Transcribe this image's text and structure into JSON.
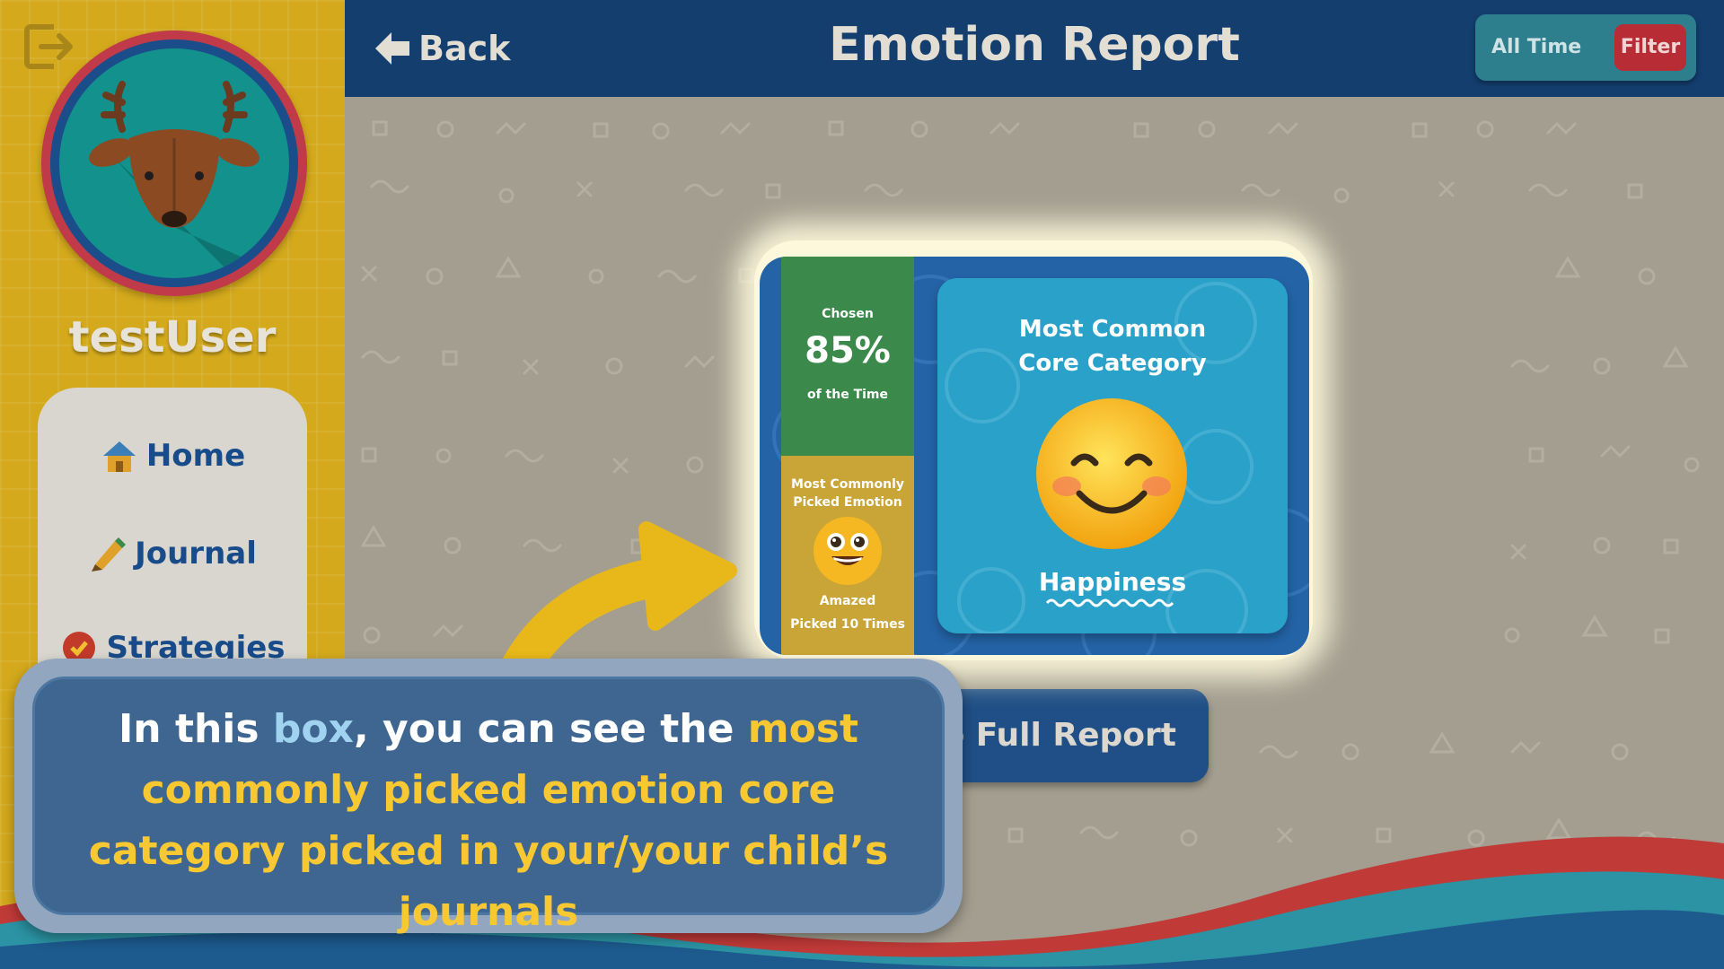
{
  "sidebar": {
    "username": "testUser",
    "nav": [
      {
        "label": "Home",
        "icon": "house-icon"
      },
      {
        "label": "Journal",
        "icon": "pencil-icon"
      },
      {
        "label": "Strategies",
        "icon": "strategies-icon"
      }
    ]
  },
  "header": {
    "back_label": "Back",
    "title": "Emotion Report",
    "range_label": "All Time",
    "filter_label": "Filter"
  },
  "card": {
    "chosen_label": "Chosen",
    "chosen_percent": "85%",
    "chosen_sub": "of the Time",
    "most_common_emotion_label_1": "Most Commonly",
    "most_common_emotion_label_2": "Picked Emotion",
    "emotion_name": "Amazed",
    "emotion_count": "Picked 10 Times",
    "category_title_1": "Most Common",
    "category_title_2": "Core Category",
    "category_name": "Happiness"
  },
  "report_button": {
    "label": "o Full Report"
  },
  "tutorial": {
    "p1": "In this ",
    "p2": "box",
    "p3": ", you can see the ",
    "p4": "most commonly picked emotion core category picked in your/your child’s journals"
  },
  "colors": {
    "sidebar": "#d4a91c",
    "header": "#133e6e",
    "filter_button": "#b82d35",
    "card_green": "#3c8a4b",
    "card_gold": "#c8a536",
    "card_teal": "#2aa1c9",
    "highlight_blue": "#9fd3ef",
    "highlight_yellow": "#f7c832"
  }
}
